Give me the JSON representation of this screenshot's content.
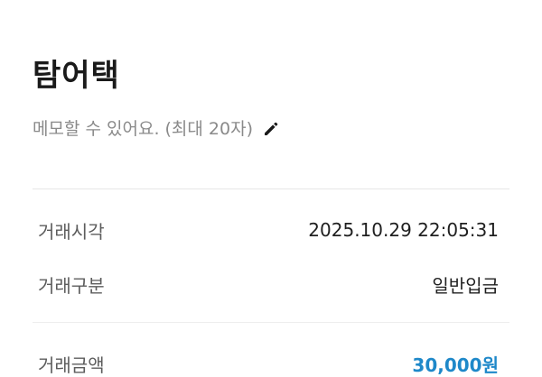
{
  "header": {
    "title": "탐어택"
  },
  "memo": {
    "placeholder_text": "메모할 수 있어요. (최대 20자)",
    "icon": "pencil-icon"
  },
  "details": {
    "time_label": "거래시각",
    "time_value": "2025.10.29 22:05:31",
    "type_label": "거래구분",
    "type_value": "일반입금",
    "amount_label": "거래금액",
    "amount_value": "30,000원"
  },
  "colors": {
    "amount_accent": "#1e88c9",
    "title": "#1a1a1a",
    "muted": "#8a8a8a"
  }
}
